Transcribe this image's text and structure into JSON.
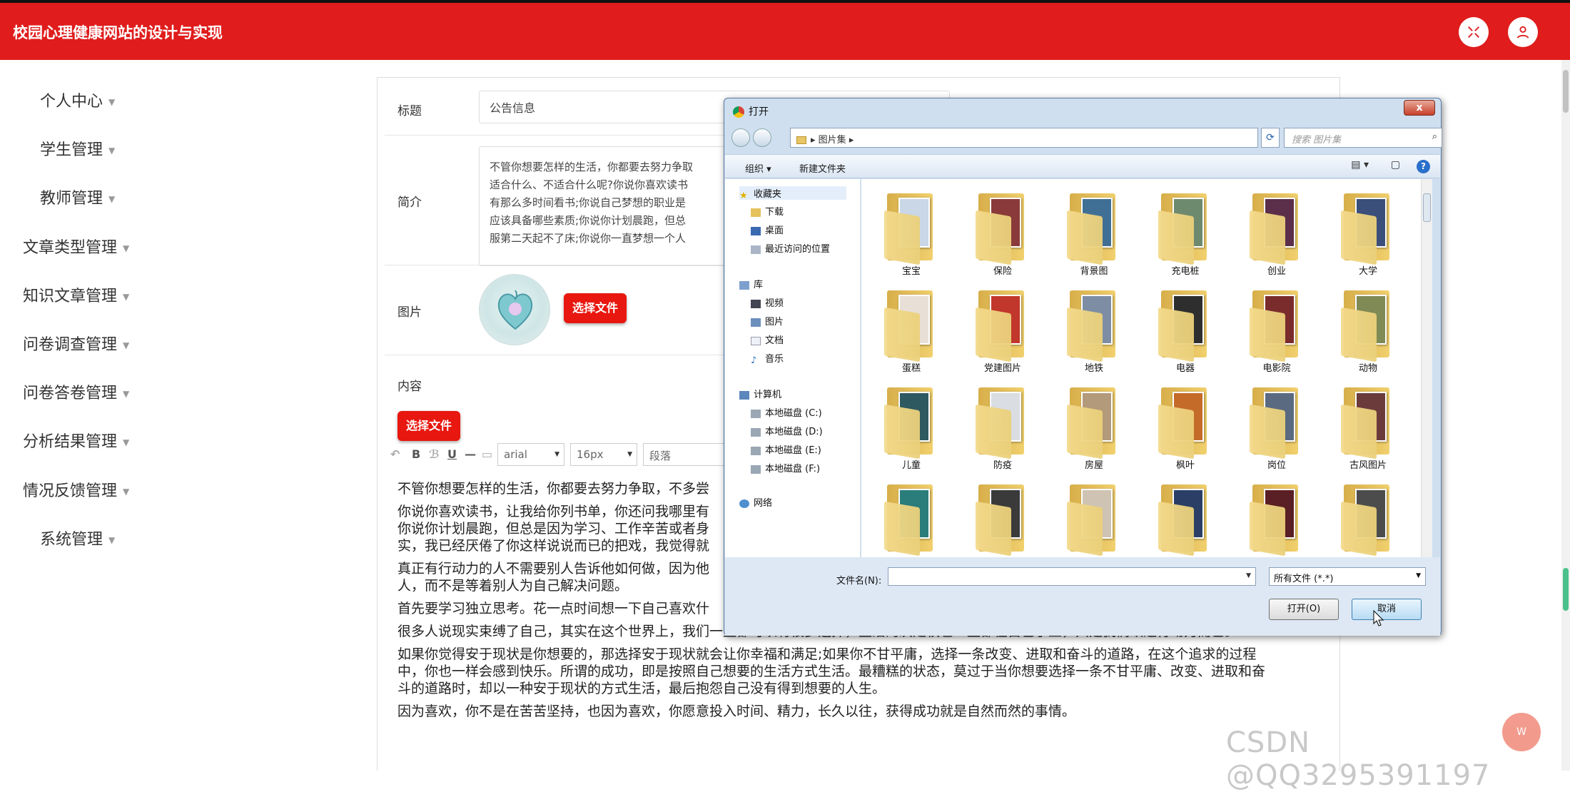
{
  "header": {
    "title": "校园心理健康网站的设计与实现",
    "accent_color": "#e01c1c",
    "icons": [
      "fullscreen-icon",
      "user-icon"
    ]
  },
  "sidebar": {
    "items": [
      {
        "label": "个人中心"
      },
      {
        "label": "学生管理"
      },
      {
        "label": "教师管理"
      },
      {
        "label": "文章类型管理"
      },
      {
        "label": "知识文章管理"
      },
      {
        "label": "问卷调查管理"
      },
      {
        "label": "问卷答卷管理"
      },
      {
        "label": "分析结果管理"
      },
      {
        "label": "情况反馈管理"
      },
      {
        "label": "系统管理"
      }
    ]
  },
  "form": {
    "title_label": "标题",
    "title_value": "公告信息",
    "intro_label": "简介",
    "intro_lines": [
      "不管你想要怎样的生活，你都要去努力争取",
      "适合什么、不适合什么呢?你说你喜欢读书",
      "有那么多时间看书;你说自己梦想的职业是",
      "应该具备哪些素质;你说你计划晨跑，但总",
      "服第二天起不了床;你说你一直梦想一个人"
    ],
    "image_label": "图片",
    "choose_file_label": "选择文件",
    "content_label": "内容",
    "content_choose_file_label": "选择文件",
    "toolbar": {
      "font": "arial",
      "size": "16px",
      "paragraph": "段落"
    },
    "content_paragraphs": [
      "不管你想要怎样的生活，你都要去努力争取，不多尝",
      "你说你喜欢读书，让我给你列书单，你还问我哪里有",
      "你说你计划晨跑，但总是因为学习、工作辛苦或者身",
      "实，我已经厌倦了你这样说说而已的把戏，我觉得就",
      "真正有行动力的人不需要别人告诉他如何做，因为他",
      "人，而不是等着别人为自己解决问题。",
      "首先要学习独立思考。花一点时间想一下自己喜欢什",
      "很多人说现实束缚了自己，其实在这个世界上，我们一直都可以有很多选择，生活的决定权也一直都在自己手上，只是我们缺乏行动力而已。",
      "如果你觉得安于现状是你想要的，那选择安于现状就会让你幸福和满足;如果你不甘平庸，选择一条改变、进取和奋斗的道路，在这个追求的过程",
      "中，你也一样会感到快乐。所谓的成功，即是按照自己想要的生活方式生活。最糟糕的状态，莫过于当你想要选择一条不甘平庸、改变、进取和奋",
      "斗的道路时，却以一种安于现状的方式生活，最后抱怨自己没有得到想要的人生。",
      "因为喜欢，你不是在苦苦坚持，也因为喜欢，你愿意投入时间、精力，长久以往，获得成功就是自然而然的事情。"
    ]
  },
  "dialog": {
    "title": "打开",
    "close_label": "x",
    "path": "图片集",
    "search_placeholder": "搜索 图片集",
    "organize_label": "组织 ▾",
    "new_folder_label": "新建文件夹",
    "nav": {
      "favorites": "收藏夹",
      "downloads": "下载",
      "desktop": "桌面",
      "recent": "最近访问的位置",
      "libraries": "库",
      "videos": "视频",
      "pictures": "图片",
      "documents": "文档",
      "music": "音乐",
      "computer": "计算机",
      "drives": [
        "本地磁盘 (C:)",
        "本地磁盘 (D:)",
        "本地磁盘 (E:)",
        "本地磁盘 (F:)"
      ],
      "network": "网络"
    },
    "folders": [
      {
        "name": "宝宝",
        "color": "#c9d7e6"
      },
      {
        "name": "保险",
        "color": "#8a3a3a"
      },
      {
        "name": "背景图",
        "color": "#3f6f94"
      },
      {
        "name": "充电桩",
        "color": "#6d8a6f"
      },
      {
        "name": "创业",
        "color": "#5b2e4a"
      },
      {
        "name": "大学",
        "color": "#3a4f7a"
      },
      {
        "name": "蛋糕",
        "color": "#e8e0d6"
      },
      {
        "name": "党建图片",
        "color": "#c2372b"
      },
      {
        "name": "地铁",
        "color": "#7d8ea4"
      },
      {
        "name": "电器",
        "color": "#2e2e2e"
      },
      {
        "name": "电影院",
        "color": "#7a2c2c"
      },
      {
        "name": "动物",
        "color": "#7f8a55"
      },
      {
        "name": "儿童",
        "color": "#2e5960"
      },
      {
        "name": "防疫",
        "color": "#dadde2"
      },
      {
        "name": "房屋",
        "color": "#b39a7a"
      },
      {
        "name": "枫叶",
        "color": "#c56b2a"
      },
      {
        "name": "岗位",
        "color": "#5a6a80"
      },
      {
        "name": "古风图片",
        "color": "#6b3b3b"
      },
      {
        "name": "",
        "color": "#2a7d7a"
      },
      {
        "name": "",
        "color": "#3a3a3a"
      },
      {
        "name": "",
        "color": "#cfc3b4"
      },
      {
        "name": "",
        "color": "#2b3e66"
      },
      {
        "name": "",
        "color": "#5a1f24"
      },
      {
        "name": "",
        "color": "#4c4c4c"
      }
    ],
    "filename_label": "文件名(N):",
    "filename_value": "",
    "filetype_value": "所有文件 (*.*)",
    "open_label": "打开(O)",
    "cancel_label": "取消"
  },
  "watermark": "CSDN @QQ3295391197",
  "float_button_label": "W"
}
